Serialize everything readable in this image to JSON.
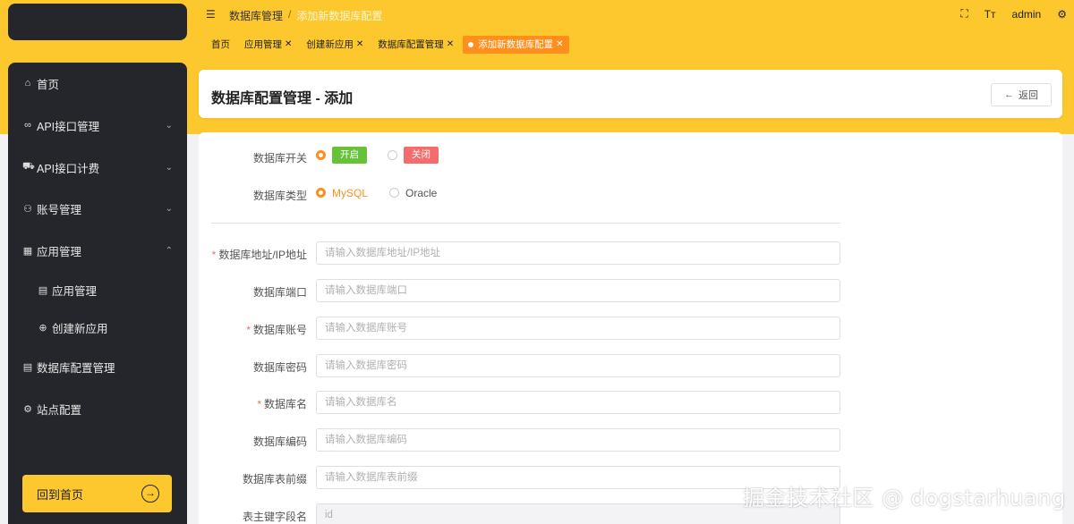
{
  "sidebar": {
    "items": [
      {
        "label": "首页",
        "icon": "home-icon"
      },
      {
        "label": "API接口管理",
        "icon": "link-icon"
      },
      {
        "label": "API接口计费",
        "icon": "cart-icon"
      },
      {
        "label": "账号管理",
        "icon": "user-icon"
      },
      {
        "label": "应用管理",
        "icon": "grid-icon"
      },
      {
        "label": "应用管理",
        "icon": "doc-icon"
      },
      {
        "label": "创建新应用",
        "icon": "plus-circle-icon"
      },
      {
        "label": "数据库配置管理",
        "icon": "doc-icon"
      },
      {
        "label": "站点配置",
        "icon": "gear-icon"
      }
    ],
    "back_home": "回到首页"
  },
  "topbar": {
    "breadcrumb": [
      "数据库管理",
      "添加新数据库配置"
    ],
    "user": "admin"
  },
  "tags": [
    "首页",
    "应用管理",
    "创建新应用",
    "数据库配置管理",
    "添加新数据库配置"
  ],
  "page": {
    "title": "数据库配置管理 - 添加",
    "return_label": "返回"
  },
  "form": {
    "switch": {
      "label": "数据库开关",
      "on": "开启",
      "off": "关闭",
      "selected": "开启"
    },
    "type": {
      "label": "数据库类型",
      "options": [
        "MySQL",
        "Oracle"
      ],
      "selected": "MySQL"
    },
    "fields": [
      {
        "label": "数据库地址/IP地址",
        "placeholder": "请输入数据库地址/IP地址",
        "required": true
      },
      {
        "label": "数据库端口",
        "placeholder": "请输入数据库端口",
        "required": false
      },
      {
        "label": "数据库账号",
        "placeholder": "请输入数据库账号",
        "required": true
      },
      {
        "label": "数据库密码",
        "placeholder": "请输入数据库密码",
        "required": false
      },
      {
        "label": "数据库名",
        "placeholder": "请输入数据库名",
        "required": true
      },
      {
        "label": "数据库编码",
        "placeholder": "请输入数据库编码",
        "required": false
      },
      {
        "label": "数据库表前缀",
        "placeholder": "请输入数据库表前缀",
        "required": false
      },
      {
        "label": "表主键字段名",
        "value": "id",
        "required": false
      }
    ]
  },
  "colors": {
    "accent": "#fdc72e",
    "active_tag": "#ff8f1c",
    "on_badge": "#67c23a",
    "off_badge": "#f56c6c",
    "sidebar": "#25262b"
  },
  "watermark": "掘金技术社区 @ dogstarhuang"
}
